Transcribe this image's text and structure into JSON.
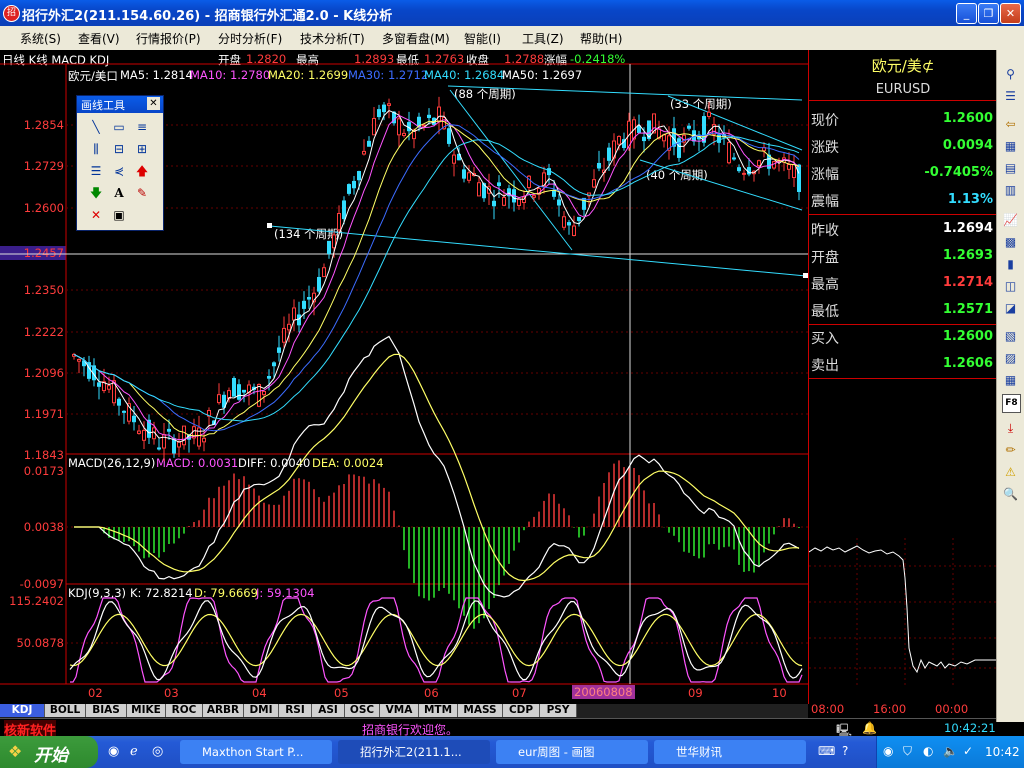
{
  "window": {
    "title": "招行外汇2(211.154.60.26) - 招商银行外汇通2.0 - K线分析",
    "app_icon": "招",
    "minimize": "_",
    "restore": "❐",
    "close": "✕"
  },
  "menu": [
    "系统(S)",
    "查看(V)",
    "行情报价(P)",
    "分时分析(F)",
    "技术分析(T)",
    "多窗看盘(M)",
    "智能(I)",
    "工具(Z)",
    "帮助(H)"
  ],
  "chart": {
    "mode_label": "日线 K线 MACD KDJ",
    "ohlc": {
      "open_label": "开盘",
      "open": "1.2820",
      "high_label": "最高",
      "high": "1.2893",
      "low_label": "最低",
      "low": "1.2763",
      "close_label": "收盘",
      "close": "1.2788",
      "change_label": "涨幅",
      "change": "-0.2418%"
    },
    "ma_line": {
      "symbol": "欧元/美口",
      "ma5": "MA5: 1.2814",
      "ma10": "MA10: 1.2780",
      "ma20": "MA20: 1.2699",
      "ma30": "MA30: 1.2712",
      "ma40": "MA40: 1.2684",
      "ma50": "MA50: 1.2697"
    },
    "price_axis": [
      "1.2854",
      "1.2729",
      "1.2600",
      "1.2457",
      "1.2350",
      "1.2222",
      "1.2096",
      "1.1971",
      "1.1843"
    ],
    "current_price_tag": "1.2457",
    "cycle_labels": [
      "(88 个周期)",
      "(33 个周期)",
      "(134 个周期)",
      "(40 个周期)"
    ],
    "macd": {
      "title": "MACD(26,12,9)",
      "macd": "MACD: 0.0031",
      "diff": "DIFF: 0.0040",
      "dea": "DEA: 0.0024",
      "axis": [
        "0.0173",
        "0.0038",
        "-0.0097"
      ]
    },
    "kdj": {
      "title": "KDJ(9,3,3)",
      "k": "K: 72.8214",
      "d": "D: 79.6669",
      "j": "J: 59.1304",
      "axis": [
        "115.2402",
        "50.0878"
      ]
    },
    "months": [
      "02",
      "03",
      "04",
      "05",
      "06",
      "07",
      "09",
      "10"
    ],
    "cursor_date": "20060808"
  },
  "palette": {
    "title": "画线工具",
    "close": "✕"
  },
  "quote_panel": {
    "name": "欧元/美⊄",
    "code": "EURUSD",
    "rows": [
      {
        "label": "现价",
        "value": "1.2600",
        "color": "#33ff33"
      },
      {
        "label": "涨跌",
        "value": "0.0094",
        "color": "#33ff33"
      },
      {
        "label": "涨幅",
        "value": "-0.7405%",
        "color": "#33ff33"
      },
      {
        "label": "震幅",
        "value": "1.13%",
        "color": "#33ddff"
      },
      {
        "label": "昨收",
        "value": "1.2694",
        "color": "#ffffff"
      },
      {
        "label": "开盘",
        "value": "1.2693",
        "color": "#33ff33"
      },
      {
        "label": "最高",
        "value": "1.2714",
        "color": "#ff3c3c"
      },
      {
        "label": "最低",
        "value": "1.2571",
        "color": "#33ff33"
      },
      {
        "label": "买入",
        "value": "1.2600",
        "color": "#33ff33"
      },
      {
        "label": "卖出",
        "value": "1.2606",
        "color": "#33ff33"
      }
    ],
    "time_axis": [
      "08:00",
      "16:00",
      "00:00"
    ]
  },
  "tabs": [
    "KDJ",
    "BOLL",
    "BIAS",
    "MIKE",
    "ROC",
    "ARBR",
    "DMI",
    "RSI",
    "ASI",
    "OSC",
    "VMA",
    "MTM",
    "MASS",
    "CDP",
    "PSY"
  ],
  "status": {
    "left": "核新软件",
    "welcome": "招商银行欢迎您。",
    "time": "10:42:21"
  },
  "taskbar": {
    "start": "开始",
    "tasks": [
      "Maxthon Start P...",
      "招行外汇2(211.1...",
      "eur周图 - 画图",
      "世华财讯"
    ],
    "clock": "10:42"
  }
}
